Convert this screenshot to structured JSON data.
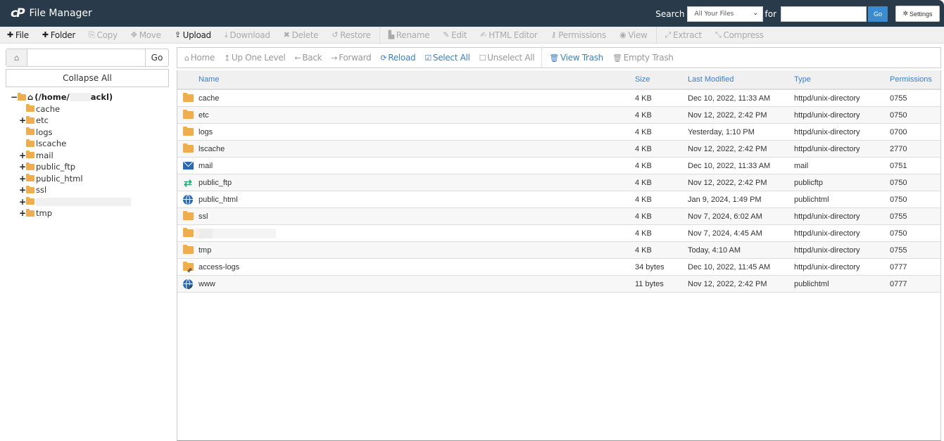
{
  "header": {
    "title": "File Manager",
    "logo": "cP",
    "search_label": "Search",
    "search_scope": "All Your Files",
    "for_label": "for",
    "search_value": "",
    "go_label": "Go",
    "settings_label": "Settings"
  },
  "toolbar": [
    {
      "label": "File",
      "icon": "plus-icon",
      "glyph": "✚",
      "enabled": true
    },
    {
      "label": "Folder",
      "icon": "plus-icon",
      "glyph": "✚",
      "enabled": true
    },
    {
      "label": "Copy",
      "icon": "copy-icon",
      "glyph": "⎘",
      "enabled": false
    },
    {
      "label": "Move",
      "icon": "move-icon",
      "glyph": "✥",
      "enabled": false
    },
    {
      "label": "Upload",
      "icon": "upload-icon",
      "glyph": "⇪",
      "enabled": true
    },
    {
      "label": "Download",
      "icon": "download-icon",
      "glyph": "⤓",
      "enabled": false
    },
    {
      "label": "Delete",
      "icon": "delete-icon",
      "glyph": "✖",
      "enabled": false
    },
    {
      "label": "Restore",
      "icon": "restore-icon",
      "glyph": "↺",
      "enabled": false
    },
    {
      "label": "Rename",
      "icon": "rename-icon",
      "glyph": "▙",
      "enabled": false
    },
    {
      "label": "Edit",
      "icon": "pencil-icon",
      "glyph": "✎",
      "enabled": false
    },
    {
      "label": "HTML Editor",
      "icon": "html-editor-icon",
      "glyph": "✍",
      "enabled": false
    },
    {
      "label": "Permissions",
      "icon": "key-icon",
      "glyph": "⚷",
      "enabled": false
    },
    {
      "label": "View",
      "icon": "eye-icon",
      "glyph": "◉",
      "enabled": false
    },
    {
      "label": "Extract",
      "icon": "extract-icon",
      "glyph": "⤢",
      "enabled": false
    },
    {
      "label": "Compress",
      "icon": "compress-icon",
      "glyph": "⤡",
      "enabled": false
    }
  ],
  "sidebar": {
    "path_value": "",
    "go_label": "Go",
    "collapse_label": "Collapse All",
    "root_label": "(/home/",
    "root_suffix": "ackl)",
    "tree": [
      {
        "label": "cache",
        "expandable": false
      },
      {
        "label": "etc",
        "expandable": true
      },
      {
        "label": "logs",
        "expandable": false
      },
      {
        "label": "lscache",
        "expandable": false
      },
      {
        "label": "mail",
        "expandable": true
      },
      {
        "label": "public_ftp",
        "expandable": true
      },
      {
        "label": "public_html",
        "expandable": true
      },
      {
        "label": "ssl",
        "expandable": true
      },
      {
        "label": "",
        "expandable": true,
        "redacted": true
      },
      {
        "label": "tmp",
        "expandable": true
      }
    ]
  },
  "navbar": [
    {
      "label": "Home",
      "icon": "home-icon",
      "glyph": "⌂",
      "enabled": false
    },
    {
      "label": "Up One Level",
      "icon": "level-up-icon",
      "glyph": "↥",
      "enabled": false
    },
    {
      "label": "Back",
      "icon": "arrow-left-icon",
      "glyph": "←",
      "enabled": false
    },
    {
      "label": "Forward",
      "icon": "arrow-right-icon",
      "glyph": "→",
      "enabled": false
    },
    {
      "label": "Reload",
      "icon": "reload-icon",
      "glyph": "⟳",
      "enabled": true
    },
    {
      "label": "Select All",
      "icon": "checkbox-checked-icon",
      "glyph": "☑",
      "enabled": true
    },
    {
      "label": "Unselect All",
      "icon": "checkbox-empty-icon",
      "glyph": "☐",
      "enabled": false
    },
    {
      "label": "View Trash",
      "icon": "trash-icon",
      "glyph": "🗑",
      "enabled": true
    },
    {
      "label": "Empty Trash",
      "icon": "trash-icon",
      "glyph": "🗑",
      "enabled": false
    }
  ],
  "table": {
    "columns": [
      "Name",
      "Size",
      "Last Modified",
      "Type",
      "Permissions"
    ],
    "rows": [
      {
        "icon": "folder",
        "name": "cache",
        "size": "4 KB",
        "modified": "Dec 10, 2022, 11:33 AM",
        "type": "httpd/unix-directory",
        "perms": "0755"
      },
      {
        "icon": "folder",
        "name": "etc",
        "size": "4 KB",
        "modified": "Nov 12, 2022, 2:42 PM",
        "type": "httpd/unix-directory",
        "perms": "0750"
      },
      {
        "icon": "folder",
        "name": "logs",
        "size": "4 KB",
        "modified": "Yesterday, 1:10 PM",
        "type": "httpd/unix-directory",
        "perms": "0700"
      },
      {
        "icon": "folder",
        "name": "lscache",
        "size": "4 KB",
        "modified": "Nov 12, 2022, 2:42 PM",
        "type": "httpd/unix-directory",
        "perms": "2770"
      },
      {
        "icon": "mail",
        "name": "mail",
        "size": "4 KB",
        "modified": "Dec 10, 2022, 11:33 AM",
        "type": "mail",
        "perms": "0751"
      },
      {
        "icon": "ftp",
        "name": "public_ftp",
        "size": "4 KB",
        "modified": "Nov 12, 2022, 2:42 PM",
        "type": "publicftp",
        "perms": "0750"
      },
      {
        "icon": "globe",
        "name": "public_html",
        "size": "4 KB",
        "modified": "Jan 9, 2024, 1:49 PM",
        "type": "publichtml",
        "perms": "0750"
      },
      {
        "icon": "folder",
        "name": "ssl",
        "size": "4 KB",
        "modified": "Nov 7, 2024, 6:02 AM",
        "type": "httpd/unix-directory",
        "perms": "0755"
      },
      {
        "icon": "folder",
        "name": "",
        "redacted": true,
        "size": "4 KB",
        "modified": "Nov 7, 2024, 4:45 AM",
        "type": "httpd/unix-directory",
        "perms": "0750"
      },
      {
        "icon": "folder",
        "name": "tmp",
        "size": "4 KB",
        "modified": "Today, 4:10 AM",
        "type": "httpd/unix-directory",
        "perms": "0755"
      },
      {
        "icon": "folder-link",
        "name": "access-logs",
        "size": "34 bytes",
        "modified": "Dec 10, 2022, 11:45 AM",
        "type": "httpd/unix-directory",
        "perms": "0777"
      },
      {
        "icon": "globe-link",
        "name": "www",
        "size": "11 bytes",
        "modified": "Nov 12, 2022, 2:42 PM",
        "type": "publichtml",
        "perms": "0777"
      }
    ]
  }
}
